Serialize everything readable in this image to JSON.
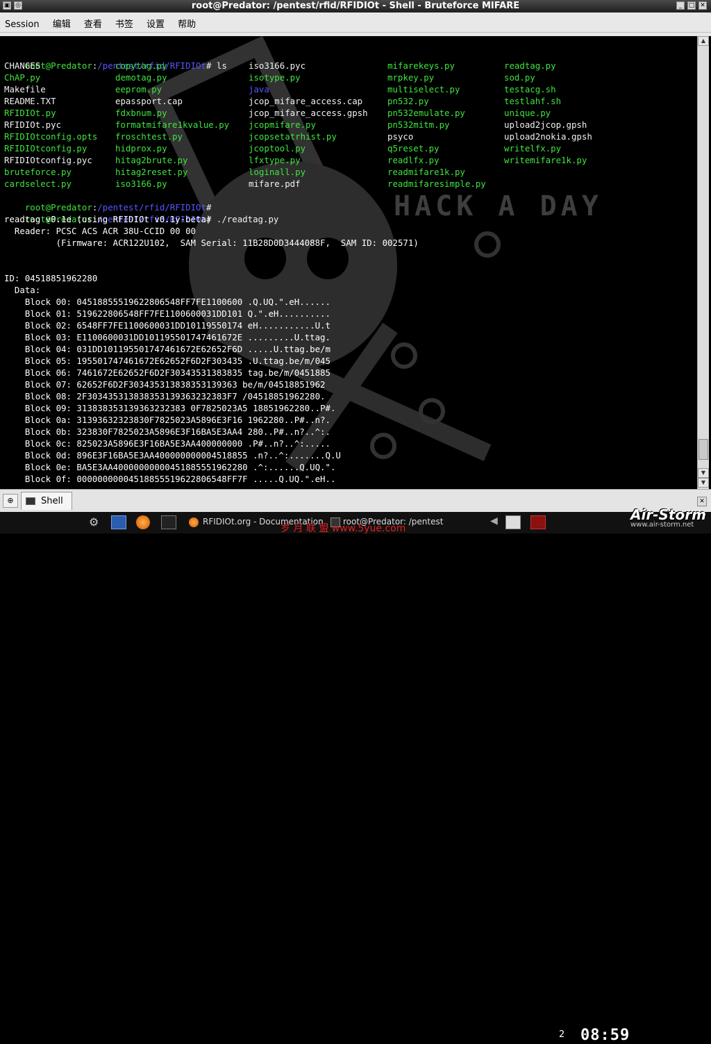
{
  "window": {
    "title": "root@Predator: /pentest/rfid/RFIDIOt - Shell - Bruteforce MIFARE"
  },
  "menu": [
    "Session",
    "编辑",
    "查看",
    "书签",
    "设置",
    "帮助"
  ],
  "colors": {
    "green": "#3fe43f",
    "white": "#f2f2f2",
    "blue": "#5656ff"
  },
  "terminal": {
    "prompt_user": "root@Predator",
    "prompt_sep": ":",
    "prompt_path": "/pentest/rfid/RFIDIOt",
    "prompt_end": "# ",
    "cmd_ls": "ls",
    "cmd_readtag": "./readtag.py",
    "ls_columns": [
      [
        {
          "t": "CHANGES",
          "c": "w"
        },
        {
          "t": "ChAP.py",
          "c": "g"
        },
        {
          "t": "Makefile",
          "c": "w"
        },
        {
          "t": "README.TXT",
          "c": "w"
        },
        {
          "t": "RFIDIOt.py",
          "c": "g"
        },
        {
          "t": "RFIDIOt.pyc",
          "c": "w"
        },
        {
          "t": "RFIDIOtconfig.opts",
          "c": "g"
        },
        {
          "t": "RFIDIOtconfig.py",
          "c": "g"
        },
        {
          "t": "RFIDIOtconfig.pyc",
          "c": "w"
        },
        {
          "t": "bruteforce.py",
          "c": "g"
        },
        {
          "t": "cardselect.py",
          "c": "g"
        }
      ],
      [
        {
          "t": "copytag.py",
          "c": "g"
        },
        {
          "t": "demotag.py",
          "c": "g"
        },
        {
          "t": "eeprom.py",
          "c": "g"
        },
        {
          "t": "epassport.cap",
          "c": "w"
        },
        {
          "t": "fdxbnum.py",
          "c": "g"
        },
        {
          "t": "formatmifare1kvalue.py",
          "c": "g"
        },
        {
          "t": "froschtest.py",
          "c": "g"
        },
        {
          "t": "hidprox.py",
          "c": "g"
        },
        {
          "t": "hitag2brute.py",
          "c": "g"
        },
        {
          "t": "hitag2reset.py",
          "c": "g"
        },
        {
          "t": "iso3166.py",
          "c": "g"
        }
      ],
      [
        {
          "t": "iso3166.pyc",
          "c": "w"
        },
        {
          "t": "isotype.py",
          "c": "g"
        },
        {
          "t": "java",
          "c": "b"
        },
        {
          "t": "jcop_mifare_access.cap",
          "c": "w"
        },
        {
          "t": "jcop_mifare_access.gpsh",
          "c": "w"
        },
        {
          "t": "jcopmifare.py",
          "c": "g"
        },
        {
          "t": "jcopsetatrhist.py",
          "c": "g"
        },
        {
          "t": "jcoptool.py",
          "c": "g"
        },
        {
          "t": "lfxtype.py",
          "c": "g"
        },
        {
          "t": "loginall.py",
          "c": "g"
        },
        {
          "t": "mifare.pdf",
          "c": "w"
        }
      ],
      [
        {
          "t": "mifarekeys.py",
          "c": "g"
        },
        {
          "t": "mrpkey.py",
          "c": "g"
        },
        {
          "t": "multiselect.py",
          "c": "g"
        },
        {
          "t": "pn532.py",
          "c": "g"
        },
        {
          "t": "pn532emulate.py",
          "c": "g"
        },
        {
          "t": "pn532mitm.py",
          "c": "g"
        },
        {
          "t": "psyco",
          "c": "w"
        },
        {
          "t": "q5reset.py",
          "c": "g"
        },
        {
          "t": "readlfx.py",
          "c": "g"
        },
        {
          "t": "readmifare1k.py",
          "c": "g"
        },
        {
          "t": "readmifaresimple.py",
          "c": "g"
        }
      ],
      [
        {
          "t": "readtag.py",
          "c": "g"
        },
        {
          "t": "sod.py",
          "c": "g"
        },
        {
          "t": "testacg.sh",
          "c": "g"
        },
        {
          "t": "testlahf.sh",
          "c": "g"
        },
        {
          "t": "unique.py",
          "c": "g"
        },
        {
          "t": "upload2jcop.gpsh",
          "c": "w"
        },
        {
          "t": "upload2nokia.gpsh",
          "c": "w"
        },
        {
          "t": "writelfx.py",
          "c": "g"
        },
        {
          "t": "writemifare1k.py",
          "c": "g"
        }
      ]
    ],
    "readtag_output": [
      "readtag v0.1e (using RFIDIOt v0.1y-beta)",
      "  Reader: PCSC ACS ACR 38U-CCID 00 00",
      "          (Firmware: ACR122U102,  SAM Serial: 11B28D0D3444088F,  SAM ID: 002571)",
      "",
      "",
      "ID: 04518851962280",
      "  Data:",
      "    Block 00: 04518855519622806548FF7FE1100600 .Q.UQ.\".eH......",
      "    Block 01: 519622806548FF7FE1100600031DD101 Q.\".eH..........",
      "    Block 02: 6548FF7FE1100600031DD10119550174 eH...........U.t",
      "    Block 03: E1100600031DD101195501747461672E .........U.ttag.",
      "    Block 04: 031DD101195501747461672E62652F6D .....U.ttag.be/m",
      "    Block 05: 195501747461672E62652F6D2F303435 .U.ttag.be/m/045",
      "    Block 06: 7461672E62652F6D2F30343531383835 tag.be/m/0451885",
      "    Block 07: 62652F6D2F303435313838353139363 be/m/04518851962",
      "    Block 08: 2F303435313838353139363232383F7 /04518851962280.",
      "    Block 09: 313838353139363232383 0F7825023A5 18851962280..P#.",
      "    Block 0a: 31393632323830F7825023A5896E3F16 1962280..P#..n?.",
      "    Block 0b: 323830F7825023A5896E3F16BA5E3AA4 280..P#..n?..^:.",
      "    Block 0c: 825023A5896E3F16BA5E3AA400000000 .P#..n?..^:.....",
      "    Block 0d: 896E3F16BA5E3AA400000000004518855 .n?..^:.......Q.U",
      "    Block 0e: BA5E3AA40000000000451885551962280 .^:......Q.UQ.\".",
      "    Block 0f: 00000000004518855519622806548FF7F .....Q.UQ.\".eH.."
    ]
  },
  "tabbar": {
    "tab_label": "Shell"
  },
  "taskbar": {
    "task1": "RFIDIOt.org - Documentation",
    "task2": "root@Predator: /pentest",
    "workspace": "2",
    "clock": "08:59"
  },
  "watermark": {
    "cn": "岁 月 联 盟   www.5yue.com",
    "brand": "Air-Storm",
    "url": "www.air-storm.net"
  }
}
